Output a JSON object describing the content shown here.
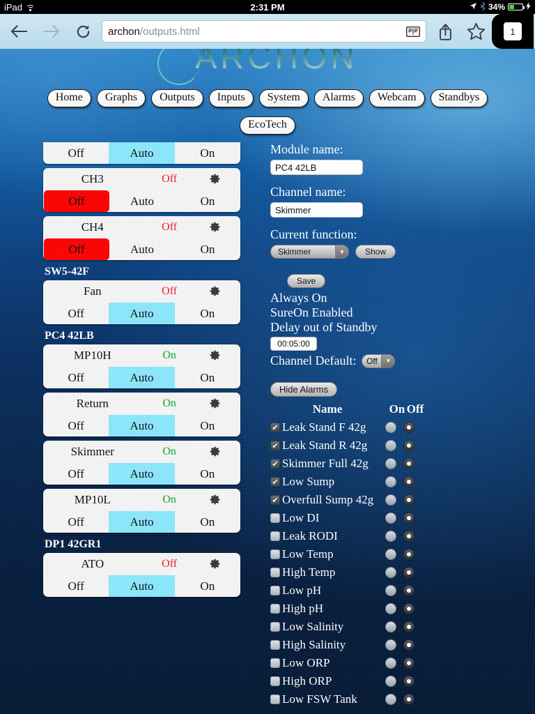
{
  "status_bar": {
    "device": "iPad",
    "wifi_icon": "wifi-icon",
    "time": "2:31 PM",
    "location_icon": "location-arrow-icon",
    "bluetooth_icon": "bluetooth-icon",
    "battery_percent": "34%",
    "battery_icon": "battery-icon",
    "charging_icon": "lightning-bolt-icon"
  },
  "toolbar": {
    "back_icon": "back-arrow-icon",
    "forward_icon": "forward-arrow-icon",
    "reload_icon": "reload-icon",
    "url_host": "archon",
    "url_path": "/outputs.html",
    "reader_icon": "reader-view-icon",
    "share_icon": "share-icon",
    "bookmark_icon": "bookmark-star-icon",
    "tab_count": "1"
  },
  "banner": {
    "logo_text": "ARCHON"
  },
  "nav": {
    "primary": [
      "Home",
      "Graphs",
      "Outputs",
      "Inputs",
      "System",
      "Alarms",
      "Webcam",
      "Standbys"
    ],
    "secondary": [
      "EcoTech"
    ]
  },
  "channels": {
    "button_labels": {
      "off": "Off",
      "auto": "Auto",
      "on": "On"
    },
    "gear_icon": "gear-icon",
    "items": [
      {
        "kind": "card",
        "clipped": true,
        "name": "",
        "state": "",
        "state_class": "",
        "show_header": false,
        "selected": "auto"
      },
      {
        "kind": "card",
        "name": "CH3",
        "state": "Off",
        "state_class": "off",
        "show_header": true,
        "selected": "off"
      },
      {
        "kind": "card",
        "name": "CH4",
        "state": "Off",
        "state_class": "off",
        "show_header": true,
        "selected": "off"
      },
      {
        "kind": "group",
        "label": "SW5-42F"
      },
      {
        "kind": "card",
        "name": "Fan",
        "state": "Off",
        "state_class": "off",
        "show_header": true,
        "selected": "auto"
      },
      {
        "kind": "group",
        "label": "PC4 42LB"
      },
      {
        "kind": "card",
        "name": "MP10H",
        "state": "On",
        "state_class": "on",
        "show_header": true,
        "selected": "auto"
      },
      {
        "kind": "card",
        "name": "Return",
        "state": "On",
        "state_class": "on",
        "show_header": true,
        "selected": "auto"
      },
      {
        "kind": "card",
        "name": "Skimmer",
        "state": "On",
        "state_class": "on",
        "show_header": true,
        "selected": "auto"
      },
      {
        "kind": "card",
        "name": "MP10L",
        "state": "On",
        "state_class": "on",
        "show_header": true,
        "selected": "auto"
      },
      {
        "kind": "group",
        "label": "DP1 42GR1"
      },
      {
        "kind": "card",
        "name": "ATO",
        "state": "Off",
        "state_class": "off",
        "show_header": true,
        "selected": "auto"
      }
    ]
  },
  "settings": {
    "module_name_label": "Module name:",
    "module_name_value": "PC4 42LB",
    "channel_name_label": "Channel name:",
    "channel_name_value": "Skimmer",
    "current_function_label": "Current function:",
    "current_function_value": "Skimmer",
    "dropdown_arrow_icon": "chevron-down-icon",
    "show_button": "Show",
    "save_button": "Save",
    "always_on": "Always On",
    "sure_on": "SureOn Enabled",
    "delay_label": "Delay out of Standby",
    "delay_value": "00:05:00",
    "channel_default_label": "Channel Default:",
    "channel_default_value": "Off",
    "hide_alarms_button": "Hide Alarms"
  },
  "alarms": {
    "header": {
      "name": "Name",
      "on": "On",
      "off": "Off"
    },
    "rows": [
      {
        "name": "Leak Stand F 42g",
        "checked": true,
        "selected": "off"
      },
      {
        "name": "Leak Stand R 42g",
        "checked": true,
        "selected": "off"
      },
      {
        "name": "Skimmer Full 42g",
        "checked": true,
        "selected": "off"
      },
      {
        "name": "Low Sump",
        "checked": true,
        "selected": "off"
      },
      {
        "name": "Overfull Sump 42g",
        "checked": true,
        "selected": "off"
      },
      {
        "name": "Low DI",
        "checked": false,
        "selected": "off"
      },
      {
        "name": "Leak RODI",
        "checked": false,
        "selected": "off"
      },
      {
        "name": "Low Temp",
        "checked": false,
        "selected": "off"
      },
      {
        "name": "High Temp",
        "checked": false,
        "selected": "off"
      },
      {
        "name": "Low pH",
        "checked": false,
        "selected": "off"
      },
      {
        "name": "High pH",
        "checked": false,
        "selected": "off"
      },
      {
        "name": "Low Salinity",
        "checked": false,
        "selected": "off"
      },
      {
        "name": "High Salinity",
        "checked": false,
        "selected": "off"
      },
      {
        "name": "Low ORP",
        "checked": false,
        "selected": "off"
      },
      {
        "name": "High ORP",
        "checked": false,
        "selected": "off"
      },
      {
        "name": "Low FSW Tank",
        "checked": false,
        "selected": "off"
      }
    ]
  },
  "colors": {
    "auto_selected": "#8ce7fb",
    "off_selected": "#fc0505",
    "state_on": "#14a32a",
    "state_off": "#e8202a",
    "battery_green": "#4cd445"
  }
}
